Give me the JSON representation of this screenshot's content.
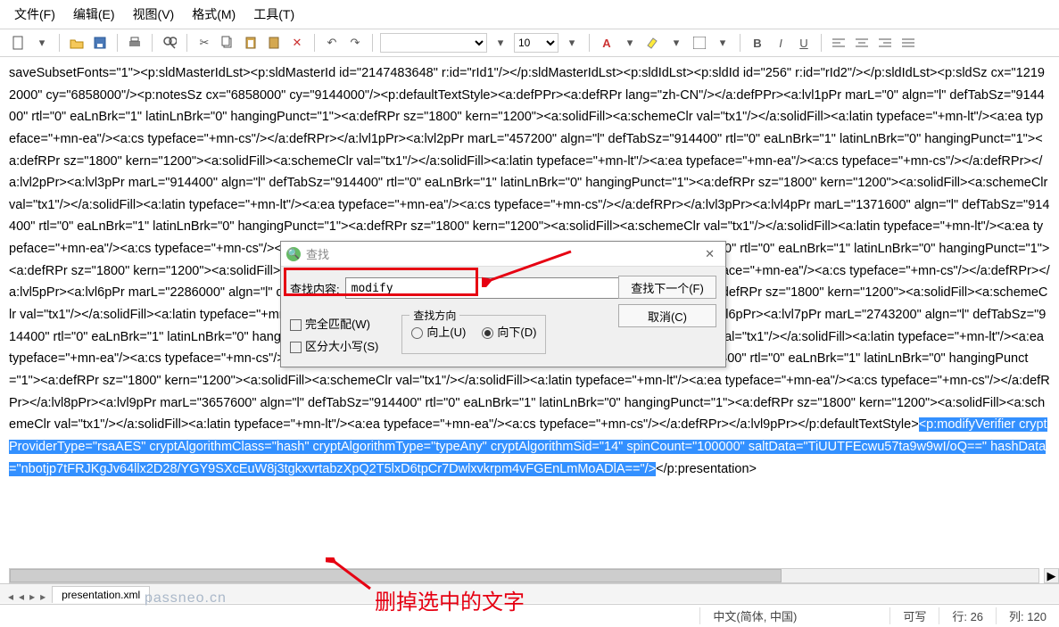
{
  "menubar": {
    "file": "文件(F)",
    "edit": "编辑(E)",
    "view": "视图(V)",
    "format": "格式(M)",
    "tools": "工具(T)"
  },
  "toolbar": {
    "fontname": "",
    "fontsize": "10"
  },
  "content": {
    "pre": "saveSubsetFonts=\"1\"><p:sldMasterIdLst><p:sldMasterId id=\"2147483648\" r:id=\"rId1\"/></p:sldMasterIdLst><p:sldIdLst><p:sldId id=\"256\" r:id=\"rId2\"/></p:sldIdLst><p:sldSz cx=\"12192000\" cy=\"6858000\"/><p:notesSz cx=\"6858000\" cy=\"9144000\"/><p:defaultTextStyle><a:defPPr><a:defRPr lang=\"zh-CN\"/></a:defPPr><a:lvl1pPr marL=\"0\" algn=\"l\" defTabSz=\"914400\" rtl=\"0\" eaLnBrk=\"1\" latinLnBrk=\"0\" hangingPunct=\"1\"><a:defRPr sz=\"1800\" kern=\"1200\"><a:solidFill><a:schemeClr val=\"tx1\"/></a:solidFill><a:latin typeface=\"+mn-lt\"/><a:ea typeface=\"+mn-ea\"/><a:cs typeface=\"+mn-cs\"/></a:defRPr></a:lvl1pPr><a:lvl2pPr marL=\"457200\" algn=\"l\" defTabSz=\"914400\" rtl=\"0\" eaLnBrk=\"1\" latinLnBrk=\"0\" hangingPunct=\"1\"><a:defRPr sz=\"1800\" kern=\"1200\"><a:solidFill><a:schemeClr val=\"tx1\"/></a:solidFill><a:latin typeface=\"+mn-lt\"/><a:ea typeface=\"+mn-ea\"/><a:cs typeface=\"+mn-cs\"/></a:defRPr></a:lvl2pPr><a:lvl3pPr marL=\"914400\" algn=\"l\" defTabSz=\"914400\" rtl=\"0\" eaLnBrk=\"1\" latinLnBrk=\"0\" hangingPunct=\"1\"><a:defRPr sz=\"1800\" kern=\"1200\"><a:solidFill><a:schemeClr val=\"tx1\"/></a:solidFill><a:latin typeface=\"+mn-lt\"/><a:ea typeface=\"+mn-ea\"/><a:cs typeface=\"+mn-cs\"/></a:defRPr></a:lvl3pPr><a:lvl4pPr marL=\"1371600\" algn=\"l\" defTabSz=\"914400\" rtl=\"0\" eaLnBrk=\"1\" latinLnBrk=\"0\" hangingPunct=\"1\"><a:defRPr sz=\"1800\" kern=\"1200\"><a:solidFill><a:schemeClr val=\"tx1\"/></a:solidFill><a:latin typeface=\"+mn-lt\"/><a:ea typeface=\"+mn-ea\"/><a:cs typeface=\"+mn-cs\"/></a:defRPr></a:lvl4pPr><a:lvl5pPr marL=\"1828800\" algn=\"l\" defTabSz=\"914400\" rtl=\"0\" eaLnBrk=\"1\" latinLnBrk=\"0\" hangingPunct=\"1\"><a:defRPr sz=\"1800\" kern=\"1200\"><a:solidFill><a:schemeClr val=\"tx1\"/></a:solidFill><a:latin typeface=\"+mn-lt\"/><a:ea typeface=\"+mn-ea\"/><a:cs typeface=\"+mn-cs\"/></a:defRPr></a:lvl5pPr><a:lvl6pPr marL=\"2286000\" algn=\"l\" defTabSz=\"914400\" rtl=\"0\" eaLnBrk=\"1\" latinLnBrk=\"0\" hangingPunct=\"1\"><a:defRPr sz=\"1800\" kern=\"1200\"><a:solidFill><a:schemeClr val=\"tx1\"/></a:solidFill><a:latin typeface=\"+mn-lt\"/><a:ea typeface=\"+mn-ea\"/><a:cs typeface=\"+mn-cs\"/></a:defRPr></a:lvl6pPr><a:lvl7pPr marL=\"2743200\" algn=\"l\" defTabSz=\"914400\" rtl=\"0\" eaLnBrk=\"1\" latinLnBrk=\"0\" hangingPunct=\"1\"><a:defRPr sz=\"1800\" kern=\"1200\"><a:solidFill><a:schemeClr val=\"tx1\"/></a:solidFill><a:latin typeface=\"+mn-lt\"/><a:ea typeface=\"+mn-ea\"/><a:cs typeface=\"+mn-cs\"/></a:defRPr></a:lvl7pPr><a:lvl8pPr marL=\"3200400\" algn=\"l\" defTabSz=\"914400\" rtl=\"0\" eaLnBrk=\"1\" latinLnBrk=\"0\" hangingPunct=\"1\"><a:defRPr sz=\"1800\" kern=\"1200\"><a:solidFill><a:schemeClr val=\"tx1\"/></a:solidFill><a:latin typeface=\"+mn-lt\"/><a:ea typeface=\"+mn-ea\"/><a:cs typeface=\"+mn-cs\"/></a:defRPr></a:lvl8pPr><a:lvl9pPr marL=\"3657600\" algn=\"l\" defTabSz=\"914400\" rtl=\"0\" eaLnBrk=\"1\" latinLnBrk=\"0\" hangingPunct=\"1\"><a:defRPr sz=\"1800\" kern=\"1200\"><a:solidFill><a:schemeClr val=\"tx1\"/></a:solidFill><a:latin typeface=\"+mn-lt\"/><a:ea typeface=\"+mn-ea\"/><a:cs typeface=\"+mn-cs\"/></a:defRPr></a:lvl9pPr></p:defaultTextStyle>",
    "sel": "<p:modifyVerifier cryptProviderType=\"rsaAES\" cryptAlgorithmClass=\"hash\" cryptAlgorithmType=\"typeAny\" cryptAlgorithmSid=\"14\" spinCount=\"100000\" saltData=\"TiUUTFEcwu57ta9w9wI/oQ==\" hashData=\"nbotjp7tFRJKgJv64llx2D28/YGY9SXcEuW8j3tgkxvrtabzXpQ2T5lxD6tpCr7Dwlxvkrpm4vFGEnLmMoADlA==\"/>",
    "post": "</p:presentation>"
  },
  "tab": {
    "name": "presentation.xml"
  },
  "find": {
    "title": "查找",
    "label": "查找内容:",
    "value": "modify",
    "match_whole": "完全匹配(W)",
    "match_case": "区分大小写(S)",
    "dir_label": "查找方向",
    "dir_up": "向上(U)",
    "dir_down": "向下(D)",
    "findnext": "查找下一个(F)",
    "cancel": "取消(C)"
  },
  "status": {
    "lang": "中文(简体, 中国)",
    "mode": "可写",
    "line_label": "行:",
    "line": "26",
    "col_label": "列:",
    "col": "120"
  },
  "anno": {
    "text": "删掉选中的文字",
    "watermark": "passneo.cn"
  }
}
